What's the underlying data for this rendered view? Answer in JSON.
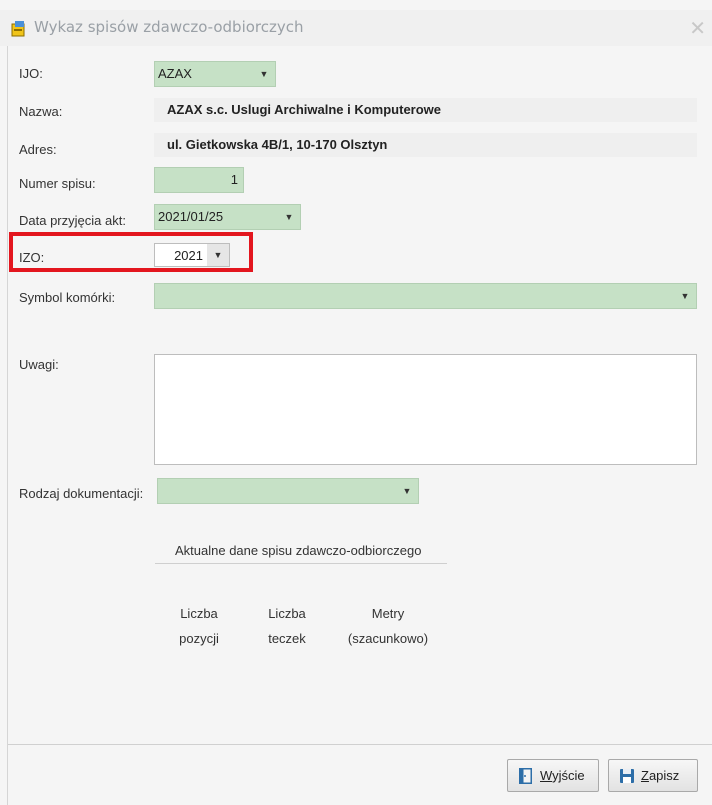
{
  "window": {
    "title": "Wykaz spisów zdawczo-odbiorczych",
    "close_glyph": "✕"
  },
  "form": {
    "ijo_label": "IJO:",
    "ijo_value": "AZAX",
    "nazwa_label": "Nazwa:",
    "nazwa_value": "AZAX s.c. Uslugi Archiwalne i Komputerowe",
    "adres_label": "Adres:",
    "adres_value": "ul. Gietkowska 4B/1, 10-170 Olsztyn",
    "numer_label": "Numer spisu:",
    "numer_value": "1",
    "data_label": "Data przyjęcia akt:",
    "data_value": "2021/01/25",
    "izo_label": "IZO:",
    "izo_value": "2021",
    "symbol_label": "Symbol komórki:",
    "symbol_value": "",
    "uwagi_label": "Uwagi:",
    "uwagi_value": "",
    "rodzaj_label": "Rodzaj dokumentacji:",
    "rodzaj_value": ""
  },
  "summary": {
    "title": "Aktualne dane spisu zdawczo-odbiorczego",
    "columns": [
      {
        "line1": "Liczba",
        "line2": "pozycji"
      },
      {
        "line1": "Liczba",
        "line2": "teczek"
      },
      {
        "line1": "Metry",
        "line2": "(szacunkowo)"
      }
    ]
  },
  "buttons": {
    "exit_label": "Wyjście",
    "exit_mnemonic": "W",
    "exit_rest": "yjście",
    "save_label": "Zapisz",
    "save_mnemonic": "Z",
    "save_rest": "apisz"
  },
  "colors": {
    "field_green": "#c6e1c6",
    "highlight_red": "#e3161e",
    "readonly_grey": "#efefef"
  },
  "icons": [
    "app-icon",
    "close-icon",
    "dropdown-arrow-icon",
    "exit-door-icon",
    "save-disk-icon"
  ]
}
